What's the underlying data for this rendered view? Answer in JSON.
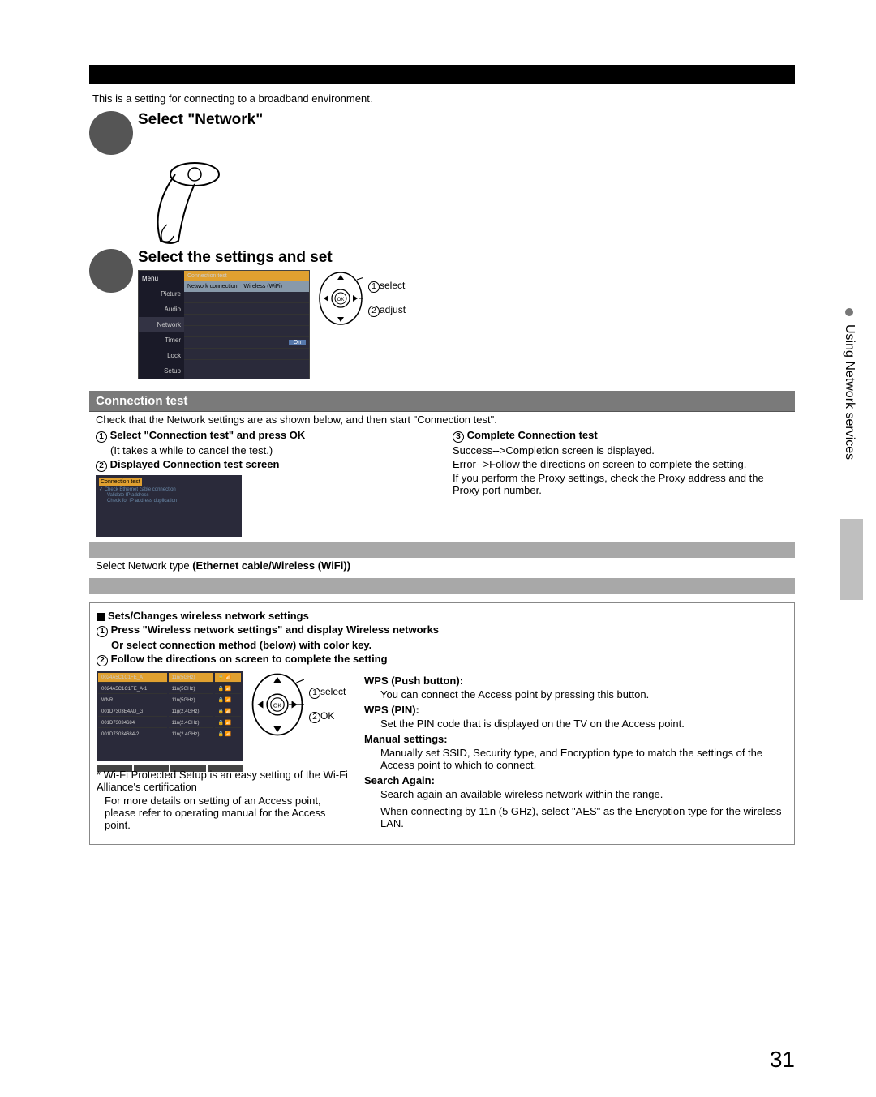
{
  "intro": "This is a setting for connecting to a broadband environment.",
  "step1": {
    "heading": "Select \"Network\""
  },
  "step2": {
    "heading": "Select the settings and set"
  },
  "menu": {
    "title": "Menu",
    "left": [
      "Picture",
      "Audio",
      "Network",
      "Timer",
      "Lock",
      "Setup"
    ],
    "right": {
      "connection_test": "Connection test",
      "row2a": "Network connection",
      "row2b": "Wireless (WiFi)",
      "on": "On"
    }
  },
  "dpad": {
    "select": "select",
    "adjust": "adjust",
    "ok": "OK"
  },
  "connection_test": {
    "title": "Connection test",
    "intro": "Check that the Network settings are as shown below, and then start \"Connection test\".",
    "step1": "Select \"Connection test\" and press OK",
    "step1_note": "(It takes a while to cancel the test.)",
    "step2": "Displayed Connection test screen",
    "step3": "Complete Connection test",
    "step3_l1": "Success-->Completion screen is displayed.",
    "step3_l2": "Error-->Follow the directions on screen to complete the setting.",
    "step3_l3": "If you perform the Proxy settings, check the Proxy address and the Proxy port number.",
    "screen_title": "Connection test",
    "screen_line1": "Check Ethernet cable connection",
    "screen_line2": "Validate IP address",
    "screen_line3": "Check for IP address duplication"
  },
  "network_connection": {
    "line": "Select Network type ",
    "bold": "(Ethernet cable/Wireless (WiFi))"
  },
  "wireless": {
    "heading": "Sets/Changes wireless network settings",
    "step1": "Press \"Wireless network settings\" and display Wireless networks",
    "step1b": "Or select connection method (below) with color key.",
    "step2": "Follow the directions on screen to complete the setting",
    "select": "select",
    "ok": "OK",
    "table": [
      {
        "ssid": "0024A5C1C1FE_A",
        "band": "11n(5GHz)",
        "sig": "4"
      },
      {
        "ssid": "0024A5C1C1FE_A-1",
        "band": "11n(5GHz)",
        "sig": "4"
      },
      {
        "ssid": "WNR",
        "band": "11n(5GHz)",
        "sig": "4"
      },
      {
        "ssid": "001D7303E4AD_G",
        "band": "11g(2.4GHz)",
        "sig": "4"
      },
      {
        "ssid": "001D73034684",
        "band": "11n(2.4GHz)",
        "sig": "4"
      },
      {
        "ssid": "001D73034684-2",
        "band": "11n(2.4GHz)",
        "sig": "4"
      }
    ],
    "note1": "* Wi-Fi Protected Setup is an easy setting of the Wi-Fi Alliance's certification",
    "note2": "For more details on setting of an Access point, please refer to operating manual for the Access point.",
    "wps_push_h": "WPS (Push button):",
    "wps_push": "You can connect the Access point by pressing this button.",
    "wps_pin_h": "WPS (PIN):",
    "wps_pin": "Set the PIN code that is displayed on the TV on the Access point.",
    "manual_h": "Manual settings:",
    "manual": "Manually set SSID, Security type, and Encryption type to match the settings of the Access point to which to connect.",
    "search_h": "Search Again:",
    "search": "Search again an available wireless network within the range.",
    "aes_note": "When connecting by 11n (5 GHz), select \"AES\" as the Encryption type for the wireless LAN."
  },
  "side_tab": "Using Network services",
  "page_number": "31"
}
